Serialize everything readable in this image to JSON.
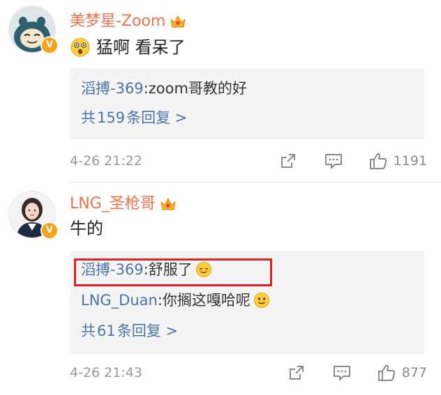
{
  "comments": [
    {
      "username": "美梦星-Zoom",
      "verified_badge": "V",
      "text": "猛啊 看呆了",
      "body_emoji_icon": "surprised-emoji-icon",
      "replies": [
        {
          "name": "滔搏-369",
          "separator": ": ",
          "text": "zoom哥教的好"
        }
      ],
      "more_prefix": "共",
      "more_count": "159",
      "more_suffix": "条回复 >",
      "time": "4-26 21:22",
      "likes": "1191"
    },
    {
      "username": "LNG_圣枪哥",
      "verified_badge": "V",
      "text": "牛的",
      "replies": [
        {
          "name": "滔搏-369",
          "separator": ": ",
          "text": "舒服了",
          "emoji_icon": "relieved-emoji-icon"
        },
        {
          "name": "LNG_Duan",
          "separator": ": ",
          "text": "你搁这嘎哈呢",
          "emoji_icon": "smile-emoji-icon"
        }
      ],
      "more_prefix": "共",
      "more_count": "61",
      "more_suffix": "条回复 >",
      "time": "4-26 21:43",
      "likes": "877"
    }
  ],
  "colors": {
    "username": "#eb7350",
    "reply_name": "#4a74a8",
    "meta": "#999999",
    "highlight": "#e02020",
    "badge": "#f7a21b"
  }
}
